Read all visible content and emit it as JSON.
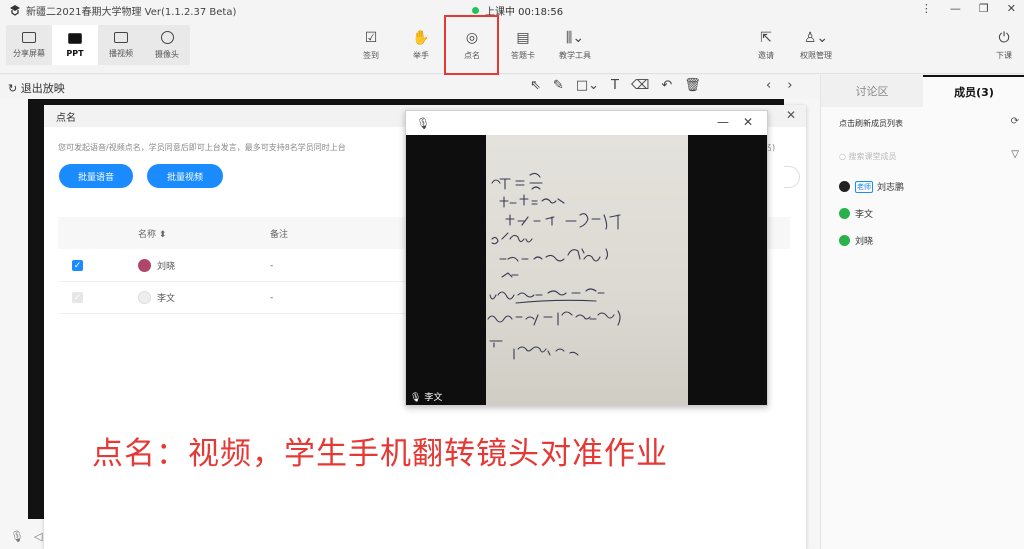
{
  "titlebar": {
    "app_title": "新疆二2021春期大学物理 Ver(1.1.2.37 Beta)",
    "live_status": "上课中 00:18:56",
    "controls": [
      "⋮",
      "—",
      "❐",
      "✕"
    ]
  },
  "toolbar": {
    "left_tools": [
      {
        "label": "分享屏幕",
        "icon": "screen-share-icon"
      },
      {
        "label": "PPT",
        "icon": "ppt-icon",
        "active": true
      },
      {
        "label": "播视频",
        "icon": "video-play-icon"
      },
      {
        "label": "摄像头",
        "icon": "camera-icon"
      }
    ],
    "center_tools": [
      {
        "label": "签到",
        "icon": "checkin-icon",
        "glyph": "☑"
      },
      {
        "label": "举手",
        "icon": "hand-icon",
        "glyph": "✋"
      },
      {
        "label": "点名",
        "icon": "rollcall-icon",
        "glyph": "◎"
      },
      {
        "label": "答题卡",
        "icon": "answer-card-icon",
        "glyph": "▤"
      },
      {
        "label": "教学工具",
        "icon": "teaching-tools-icon",
        "glyph": "⫼⌄"
      }
    ],
    "right_tools": [
      {
        "label": "邀请",
        "icon": "invite-icon",
        "glyph": "⇱"
      },
      {
        "label": "权限管理",
        "icon": "permission-icon",
        "glyph": "♙⌄"
      },
      {
        "label": "下课",
        "icon": "end-class-icon",
        "glyph": "⏻"
      }
    ]
  },
  "subbar": {
    "exit_label": "退出放映",
    "draw_tools": [
      "⇖",
      "✎",
      "□⌄",
      "T",
      "⌫",
      "↶",
      "🗑"
    ],
    "nav": [
      "‹",
      "›"
    ]
  },
  "rollcall": {
    "title": "点名",
    "desc": "您可发起语音/视频点名，学员同意后即可上台发言，最多可支持8名学员同时上台",
    "desc_tail": "名)",
    "btn_voice": "批量语音",
    "btn_video": "批量视频",
    "col_name": "名称 ⬍",
    "col_note": "备注",
    "rows": [
      {
        "name": "刘晓",
        "note": "-",
        "checked": true
      },
      {
        "name": "李文",
        "note": "-",
        "checked": false
      }
    ]
  },
  "video": {
    "student_name": "李文",
    "minimize": "—",
    "close": "✕"
  },
  "caption": "点名：视频，学生手机翻转镜头对准作业",
  "right_panel": {
    "tabs": [
      "讨论区",
      "成员(3)"
    ],
    "refresh_label": "点击刷新成员列表",
    "search_placeholder": "搜索课堂成员",
    "members": [
      {
        "name": "刘志鹏",
        "role": "老师",
        "icon": "qq-icon"
      },
      {
        "name": "李文",
        "role": "",
        "icon": "wechat-icon"
      },
      {
        "name": "刘晓",
        "role": "",
        "icon": "wechat-icon"
      }
    ]
  },
  "colors": {
    "accent": "#1a8cff",
    "highlight": "#e53935",
    "live": "#21c45a",
    "wechat": "#2ab24a"
  }
}
